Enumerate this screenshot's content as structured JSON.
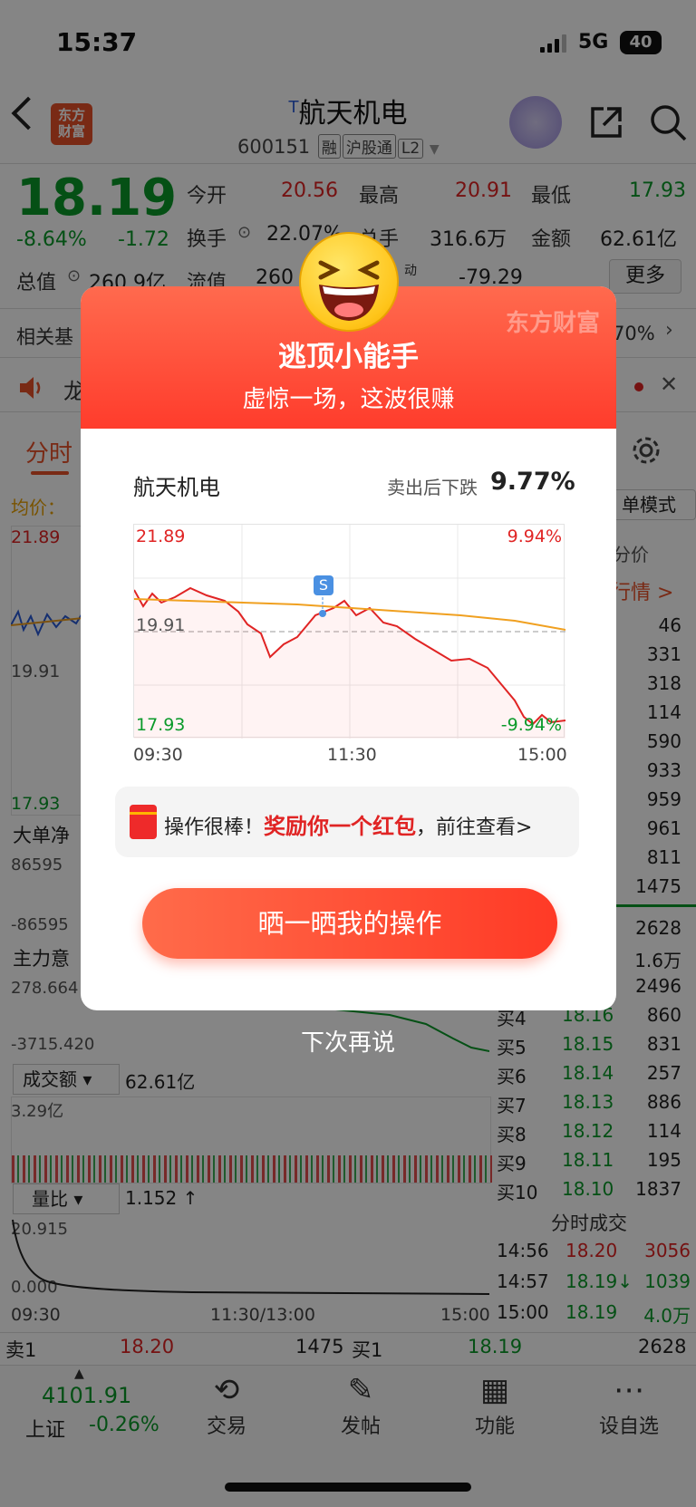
{
  "status_bar": {
    "time": "15:37",
    "network": "5G",
    "battery": "40"
  },
  "header": {
    "title": "航天机电",
    "title_prefix": "T",
    "code": "600151",
    "tags": [
      "融",
      "沪股通",
      "L2"
    ],
    "logo_line1": "东方",
    "logo_line2": "财富"
  },
  "quote": {
    "price": "18.19",
    "change_pct": "-8.64%",
    "change": "-1.72",
    "open_label": "今开",
    "open": "20.56",
    "high_label": "最高",
    "high": "20.91",
    "low_label": "最低",
    "low": "17.93",
    "turnover_label": "换手",
    "turnover": "22.07%",
    "volume_label": "总手",
    "volume": "316.6万",
    "amount_label": "金额",
    "amount": "62.61亿",
    "mktcap_label": "总值",
    "mktcap": "260.9亿",
    "float_label": "流值",
    "float": "260",
    "pe_partial_label": "动",
    "pe": "-79.29",
    "more_label": "更多"
  },
  "background": {
    "related_label": "相关基",
    "related_value": "70%",
    "news_partial": "龙",
    "tab_time": "分时",
    "avg_label": "均价：",
    "mode_label": "单模式",
    "price_col": "分价",
    "market_link": "行情 >",
    "chart_top": "21.89",
    "chart_mid": "19.91",
    "chart_low": "17.93",
    "big_order_label": "大单净",
    "big_order_hi": "86595",
    "big_order_lo": "-86595",
    "main_label": "主力意",
    "main_hi": "278.664",
    "main_lo": "-3715.420",
    "turnover_label": "成交额",
    "turnover_val": "62.61亿",
    "turnover_max": "3.29亿",
    "ratio_label": "量比",
    "ratio_val": "1.152 ↑",
    "ratio_max": "20.915",
    "ratio_min": "0.000",
    "x_start": "09:30",
    "x_mid": "11:30/13:00",
    "x_end": "15:00"
  },
  "order_book": {
    "sell_volumes": [
      "46",
      "331",
      "318",
      "114",
      "590",
      "933",
      "959",
      "961",
      "811",
      "1475"
    ],
    "buy_top_volumes": [
      "2628",
      "1.6万",
      "2496"
    ],
    "buy_rows": [
      {
        "label": "买4",
        "price": "18.16",
        "vol": "860"
      },
      {
        "label": "买5",
        "price": "18.15",
        "vol": "831"
      },
      {
        "label": "买6",
        "price": "18.14",
        "vol": "257"
      },
      {
        "label": "买7",
        "price": "18.13",
        "vol": "886"
      },
      {
        "label": "买8",
        "price": "18.12",
        "vol": "114"
      },
      {
        "label": "买9",
        "price": "18.11",
        "vol": "195"
      },
      {
        "label": "买10",
        "price": "18.10",
        "vol": "1837"
      }
    ],
    "trades_title": "分时成交",
    "trades": [
      {
        "time": "14:56",
        "price": "18.20",
        "vol": "3056"
      },
      {
        "time": "14:57",
        "price": "18.19↓",
        "vol": "1039"
      },
      {
        "time": "15:00",
        "price": "18.19",
        "vol": "4.0万"
      }
    ]
  },
  "footer_quote": {
    "sell1_label": "卖1",
    "sell1_price": "18.20",
    "sell1_vol": "1475",
    "buy1_label": "买1",
    "buy1_price": "18.19",
    "buy1_vol": "2628"
  },
  "bottom_nav": {
    "index_value": "4101.91",
    "index_name": "上证",
    "index_change": "-0.26%",
    "items": [
      {
        "label": "交易",
        "icon": "yen-exchange-icon"
      },
      {
        "label": "发帖",
        "icon": "edit-icon"
      },
      {
        "label": "功能",
        "icon": "grid-icon"
      },
      {
        "label": "设自选",
        "icon": "more-icon"
      }
    ]
  },
  "modal": {
    "brand": "东方财富",
    "title": "逃顶小能手",
    "subtitle": "虚惊一场，这波很赚",
    "stock_name": "航天机电",
    "sell_label": "卖出后下跌",
    "sell_value": "9.77%",
    "chart_labels": {
      "top_left": "21.89",
      "top_right": "9.94%",
      "mid_left": "19.91",
      "bottom_left": "17.93",
      "bottom_right": "-9.94%",
      "x_start": "09:30",
      "x_mid": "11:30",
      "x_end": "15:00",
      "marker": "S"
    },
    "reward_prefix": "操作很棒！",
    "reward_highlight": "奖励你一个红包",
    "reward_suffix": "，前往查看>",
    "share_button": "晒一晒我的操作",
    "dismiss": "下次再说"
  }
}
